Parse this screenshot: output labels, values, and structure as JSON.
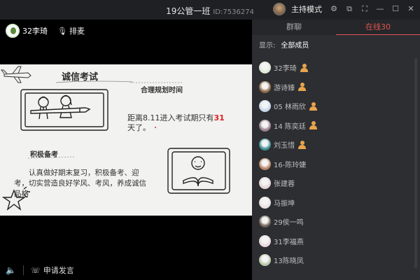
{
  "window": {
    "title": "19公管一班",
    "room_id": "ID:7536274",
    "mode_label": "主持模式"
  },
  "stage": {
    "host_name": "32李琦",
    "mic_queue_label": "排麦",
    "apply_speak_label": "申请发言"
  },
  "slide": {
    "title": "诚信考试",
    "subtitle_plan": "合理规划时间",
    "countdown_prefix": "距离8.11进入考试期只有",
    "countdown_days": "31",
    "countdown_suffix": "天了。",
    "subtitle_prepare": "积极备考",
    "body": "认真做好期末复习，积极备考、迎考，切实营造良好学风、考风，养成诚信品格"
  },
  "panel": {
    "tabs": [
      {
        "label": "群聊",
        "active": false
      },
      {
        "label": "在线30",
        "active": true
      }
    ],
    "filter_label": "显示:",
    "filter_value": "全部成员",
    "members": [
      {
        "name": "32李琦",
        "badge": true,
        "avatar_color": "#dfe9d6"
      },
      {
        "name": "游诗臻",
        "badge": true,
        "avatar_color": "#8d6a4a"
      },
      {
        "name": "05 林雨欣",
        "badge": true,
        "avatar_color": "#c5d7ea"
      },
      {
        "name": "14 陈奕廷",
        "badge": true,
        "avatar_color": "#9a7f8c"
      },
      {
        "name": "刘玉惜",
        "badge": true,
        "avatar_color": "#3f8f95"
      },
      {
        "name": "16-陈玲婕",
        "badge": false,
        "avatar_color": "#b98466"
      },
      {
        "name": "张建蓉",
        "badge": false,
        "avatar_color": "#e7d4d6"
      },
      {
        "name": "马振坤",
        "badge": false,
        "avatar_color": "#e9e0e3"
      },
      {
        "name": "29侯一鸣",
        "badge": false,
        "avatar_color": "#6f6356"
      },
      {
        "name": "31李福燕",
        "badge": false,
        "avatar_color": "#ead8dc"
      },
      {
        "name": "13陈晓凤",
        "badge": false,
        "avatar_color": "#b9c8a8"
      }
    ]
  }
}
